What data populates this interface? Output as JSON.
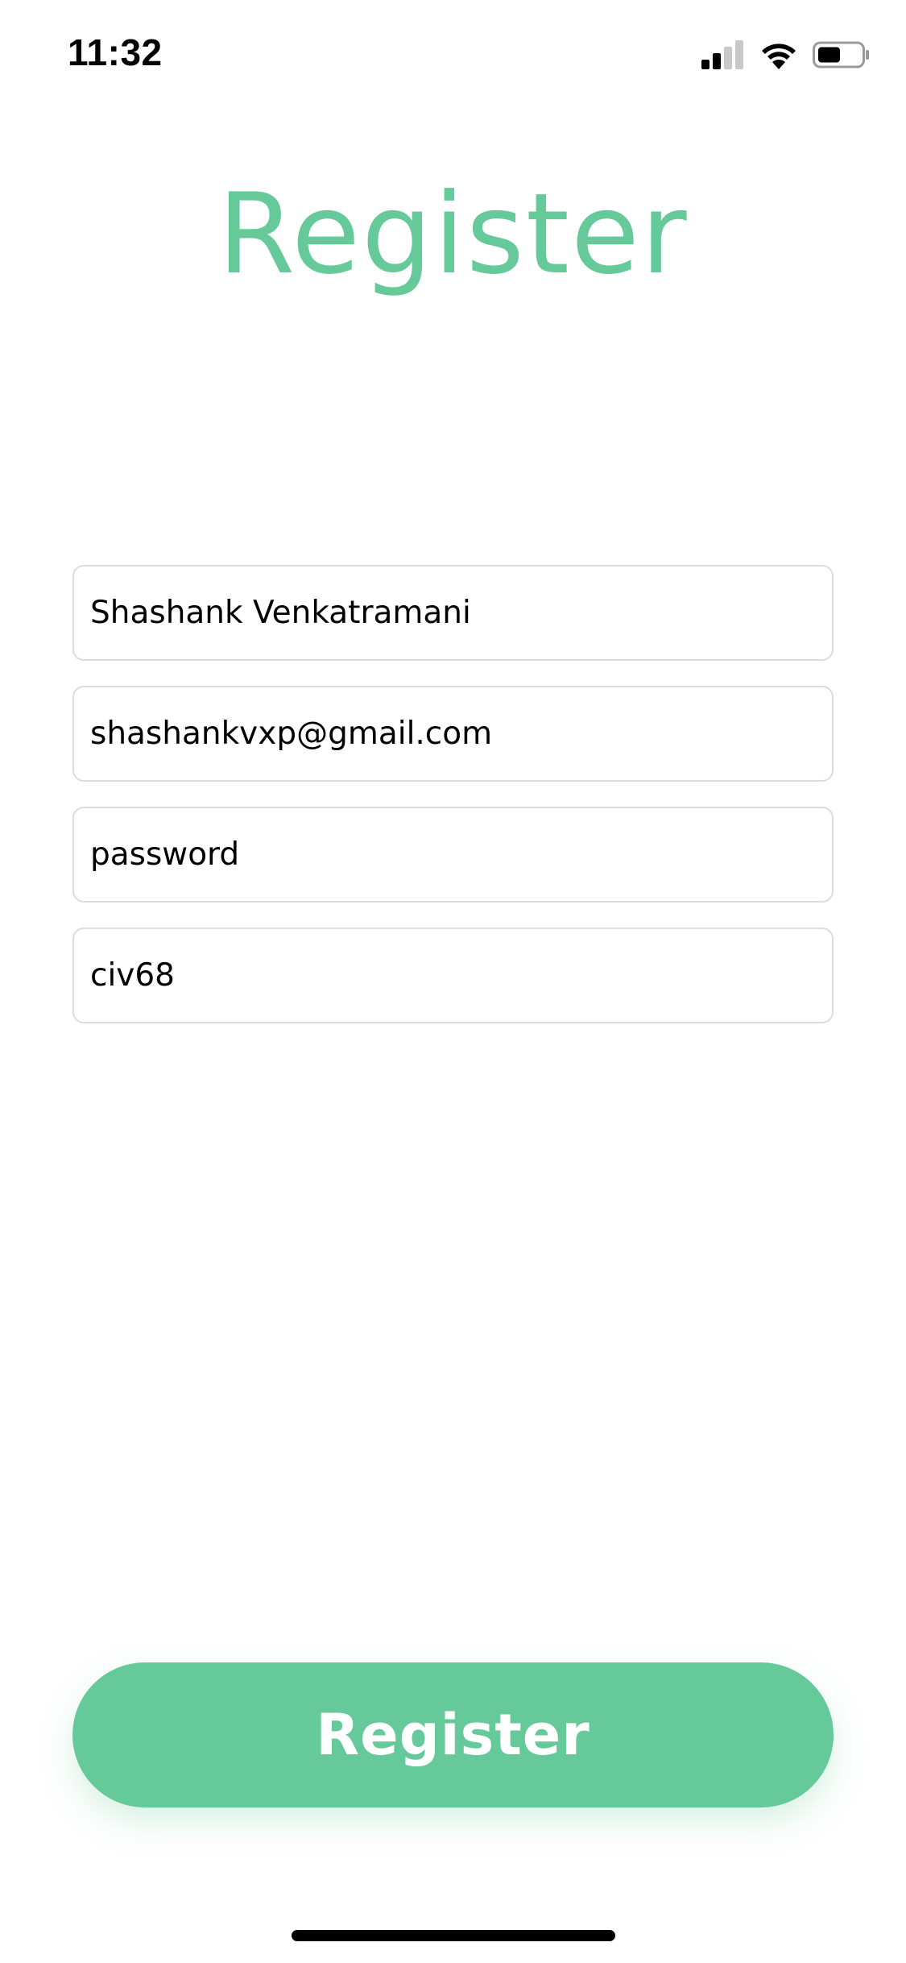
{
  "status_bar": {
    "time": "11:32",
    "icons": [
      "signal-icon",
      "wifi-icon",
      "battery-icon"
    ]
  },
  "title": "Register",
  "form": {
    "name_field": {
      "value": "Shashank Venkatramani"
    },
    "email_field": {
      "value": "shashankvxp@gmail.com"
    },
    "password_field": {
      "value": "password"
    },
    "code_field": {
      "value": "civ68"
    }
  },
  "register_button": {
    "label": "Register"
  },
  "colors": {
    "accent": "#66C999",
    "text": "#000000",
    "field_border": "#DCDCDC",
    "background": "#FFFFFF"
  }
}
